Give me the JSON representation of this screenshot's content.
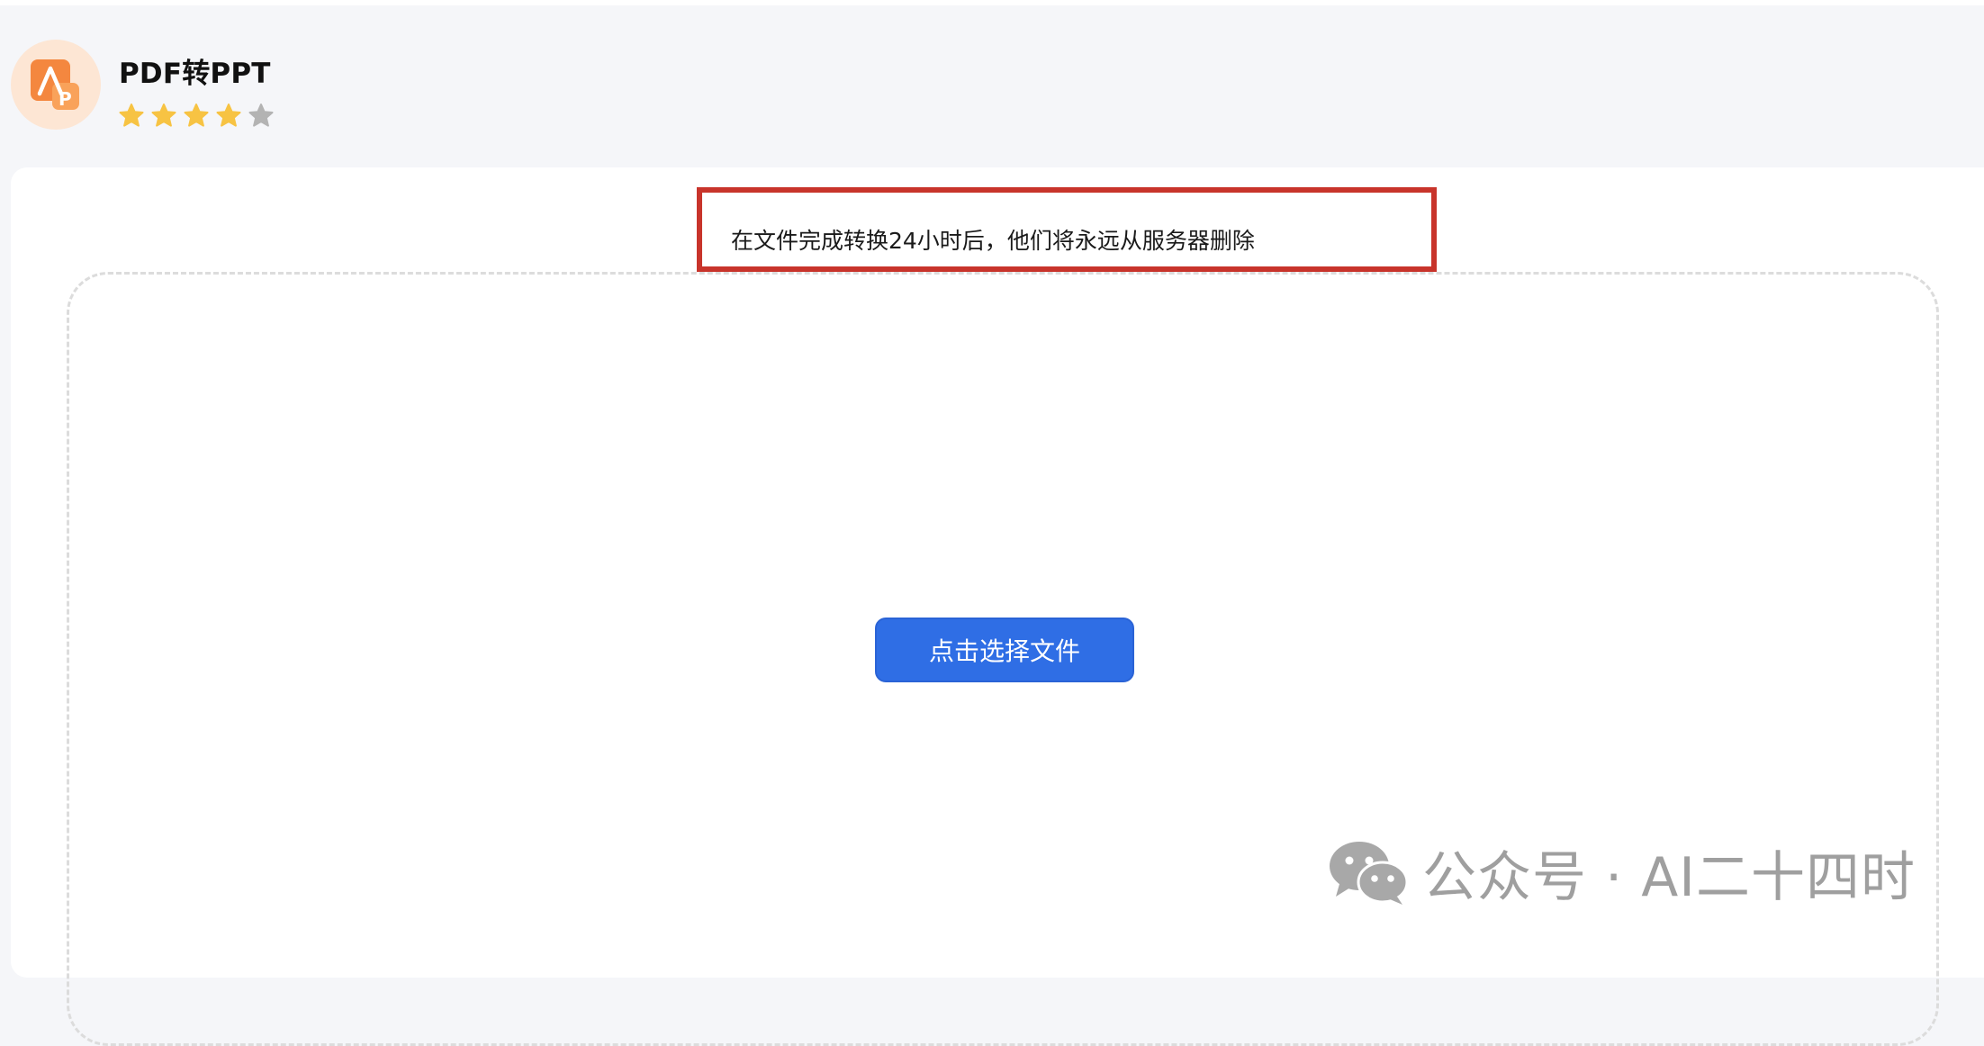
{
  "app": {
    "title": "PDF转PPT",
    "logo_icon": "pdf-to-ppt-logo-icon",
    "rating": {
      "value": 4,
      "max": 5,
      "filled_color": "#f7c343",
      "empty_color": "#b3b3b3"
    }
  },
  "notice": {
    "text": "在文件完成转换24小时后，他们将永远从服务器删除",
    "highlight_color": "#c8342b"
  },
  "upload": {
    "button_label": "点击选择文件",
    "button_color": "#2f6ee5"
  },
  "watermark": {
    "icon": "wechat-icon",
    "text": "公众号 · AI二十四时"
  }
}
